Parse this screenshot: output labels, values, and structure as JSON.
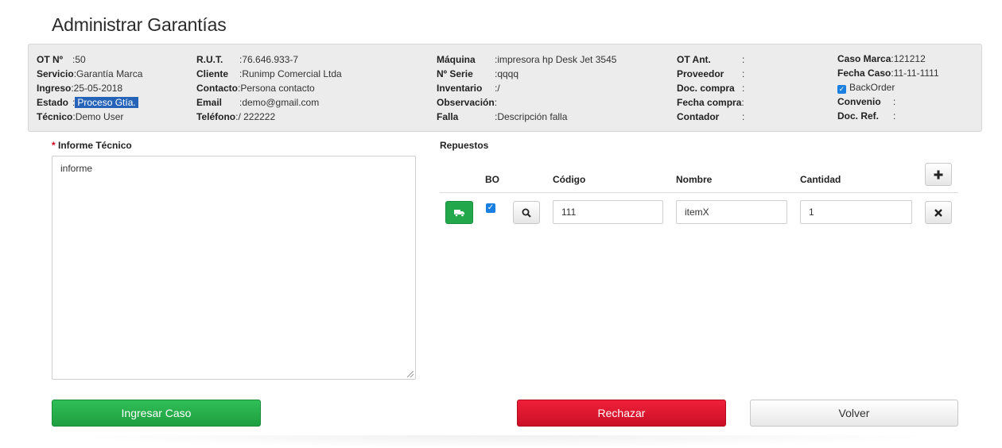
{
  "page": {
    "title": "Administrar Garantías"
  },
  "info": {
    "col1": [
      {
        "label": "OT Nº",
        "value": ":50"
      },
      {
        "label": "Servicio",
        "value": ":Garantía Marca"
      },
      {
        "label": "Ingreso",
        "value": ":25-05-2018"
      },
      {
        "label": "Estado",
        "value": ":",
        "highlight": "Proceso Gtía."
      },
      {
        "label": "Técnico",
        "value": ":Demo User"
      }
    ],
    "col2": [
      {
        "label": "R.U.T.",
        "value": ":76.646.933-7"
      },
      {
        "label": "Cliente",
        "value": ":Runimp Comercial Ltda"
      },
      {
        "label": "Contacto",
        "value": ":Persona contacto"
      },
      {
        "label": "Email",
        "value": ":demo@gmail.com"
      },
      {
        "label": "Teléfono",
        "value": ":/ 222222"
      }
    ],
    "col3": [
      {
        "label": "Máquina",
        "value": ":impresora hp Desk Jet 3545"
      },
      {
        "label": "Nº Serie",
        "value": ":qqqq"
      },
      {
        "label": "Inventario",
        "value": ":/"
      },
      {
        "label": "Observación",
        "value": ":"
      },
      {
        "label": "Falla",
        "value": ":Descripción falla"
      }
    ],
    "col4": [
      {
        "label": "OT Ant.",
        "value": ":"
      },
      {
        "label": "Proveedor",
        "value": ":"
      },
      {
        "label": "Doc. compra",
        "value": ":"
      },
      {
        "label": "Fecha compra",
        "value": ":"
      },
      {
        "label": "Contador",
        "value": ":"
      }
    ],
    "col5": [
      {
        "label": "Caso Marca",
        "value": ":121212"
      },
      {
        "label": "Fecha Caso",
        "value": ":11-11-1111"
      },
      {
        "label": "",
        "value": "BackOrder",
        "checkbox": true
      },
      {
        "label": "Convenio",
        "value": ":"
      },
      {
        "label": "Doc. Ref.",
        "value": ":"
      }
    ]
  },
  "informe": {
    "label": "Informe Técnico",
    "required_mark": "*",
    "value": "informe"
  },
  "repuestos": {
    "label": "Repuestos",
    "headers": {
      "bo": "BO",
      "codigo": "Código",
      "nombre": "Nombre",
      "cantidad": "Cantidad"
    },
    "add_icon": "plus-icon",
    "rows": [
      {
        "truck_icon": "truck-icon",
        "bo_checked": true,
        "search_icon": "search-icon",
        "codigo": "111",
        "nombre": "itemX",
        "cantidad": "1",
        "delete_icon": "close-icon"
      }
    ]
  },
  "actions": {
    "ingresar": "Ingresar Caso",
    "rechazar": "Rechazar",
    "volver": "Volver"
  },
  "colors": {
    "green": "#22a84a",
    "red": "#d81129",
    "checkbox_blue": "#1a7fe0",
    "highlight_blue": "#2463b8"
  }
}
